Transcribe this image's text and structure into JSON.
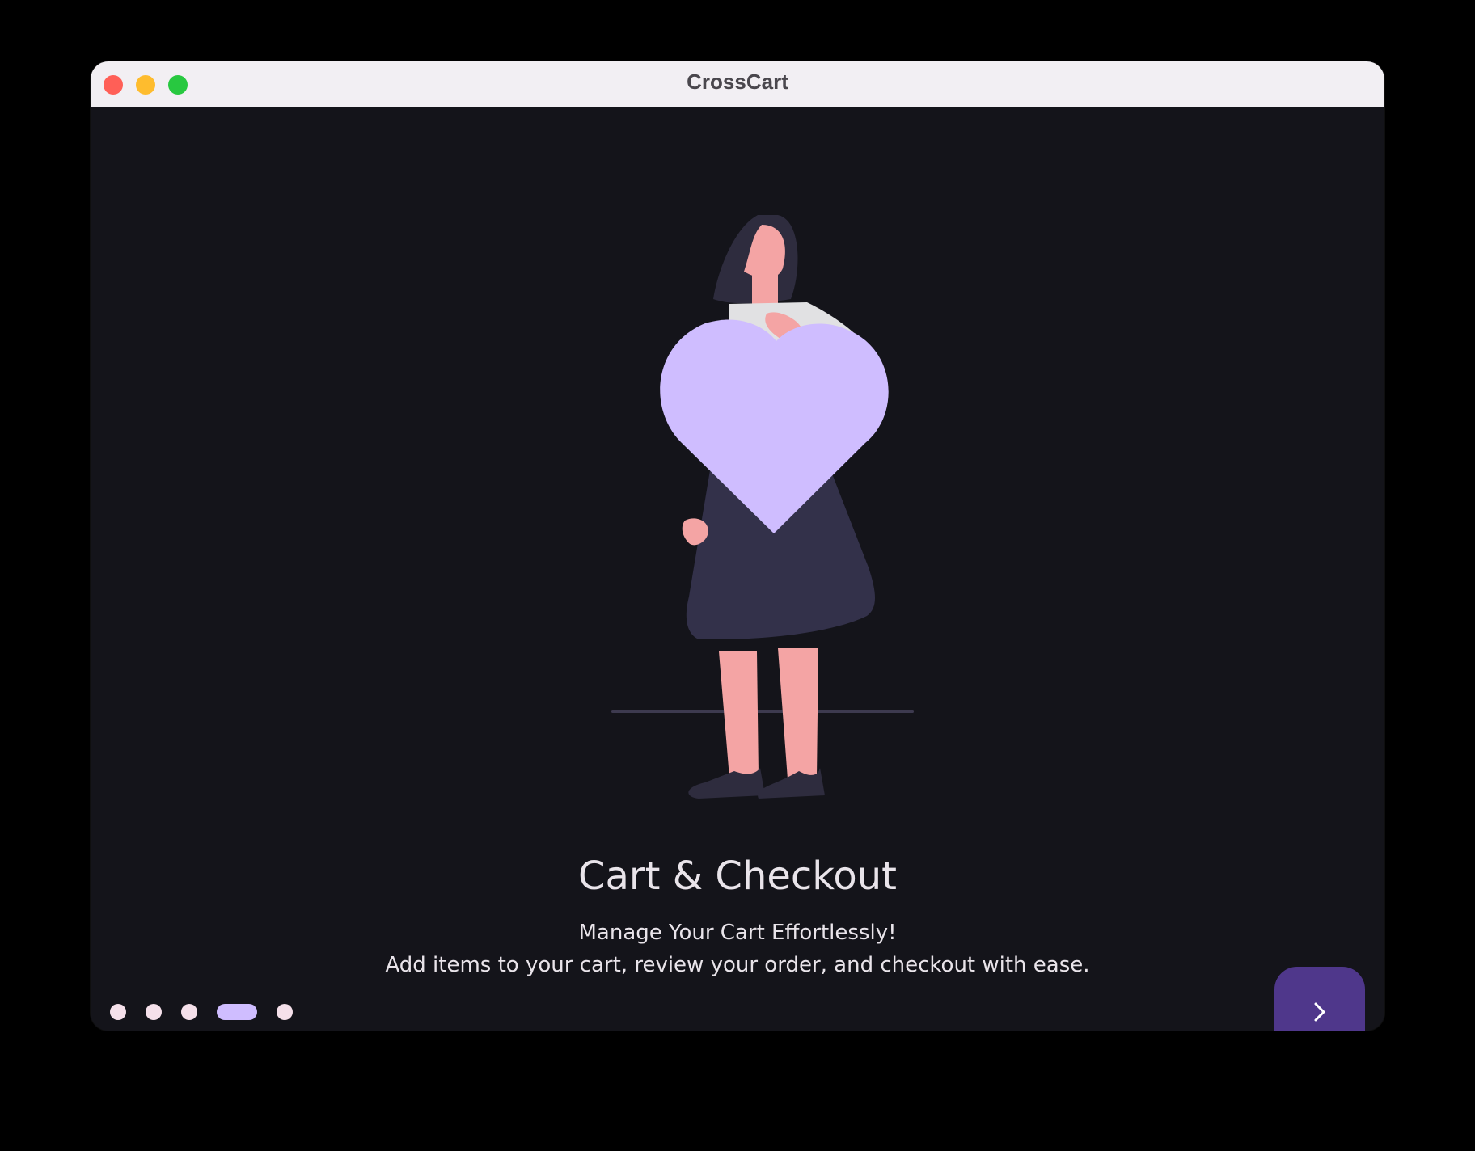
{
  "window": {
    "title": "CrossCart",
    "controls": {
      "close_color": "#ff5f57",
      "minimize_color": "#febc2e",
      "maximize_color": "#28c840"
    }
  },
  "onboarding": {
    "heading": "Cart & Checkout",
    "subheading": "Manage Your Cart Effortlessly!",
    "description": "Add items to your cart, review your order, and checkout with ease.",
    "illustration_icon": "woman-holding-heart-illustration",
    "page_indicator": {
      "total_pages": 5,
      "current_page": 4,
      "active_color": "#cfbdff",
      "inactive_color": "#f5e0ea"
    },
    "next_button": {
      "icon": "chevron-right-icon",
      "color": "#4f378b"
    }
  },
  "colors": {
    "background": "#14141a",
    "titlebar": "#f2eff3",
    "accent": "#cfbdff",
    "text": "#e9e4ea"
  }
}
